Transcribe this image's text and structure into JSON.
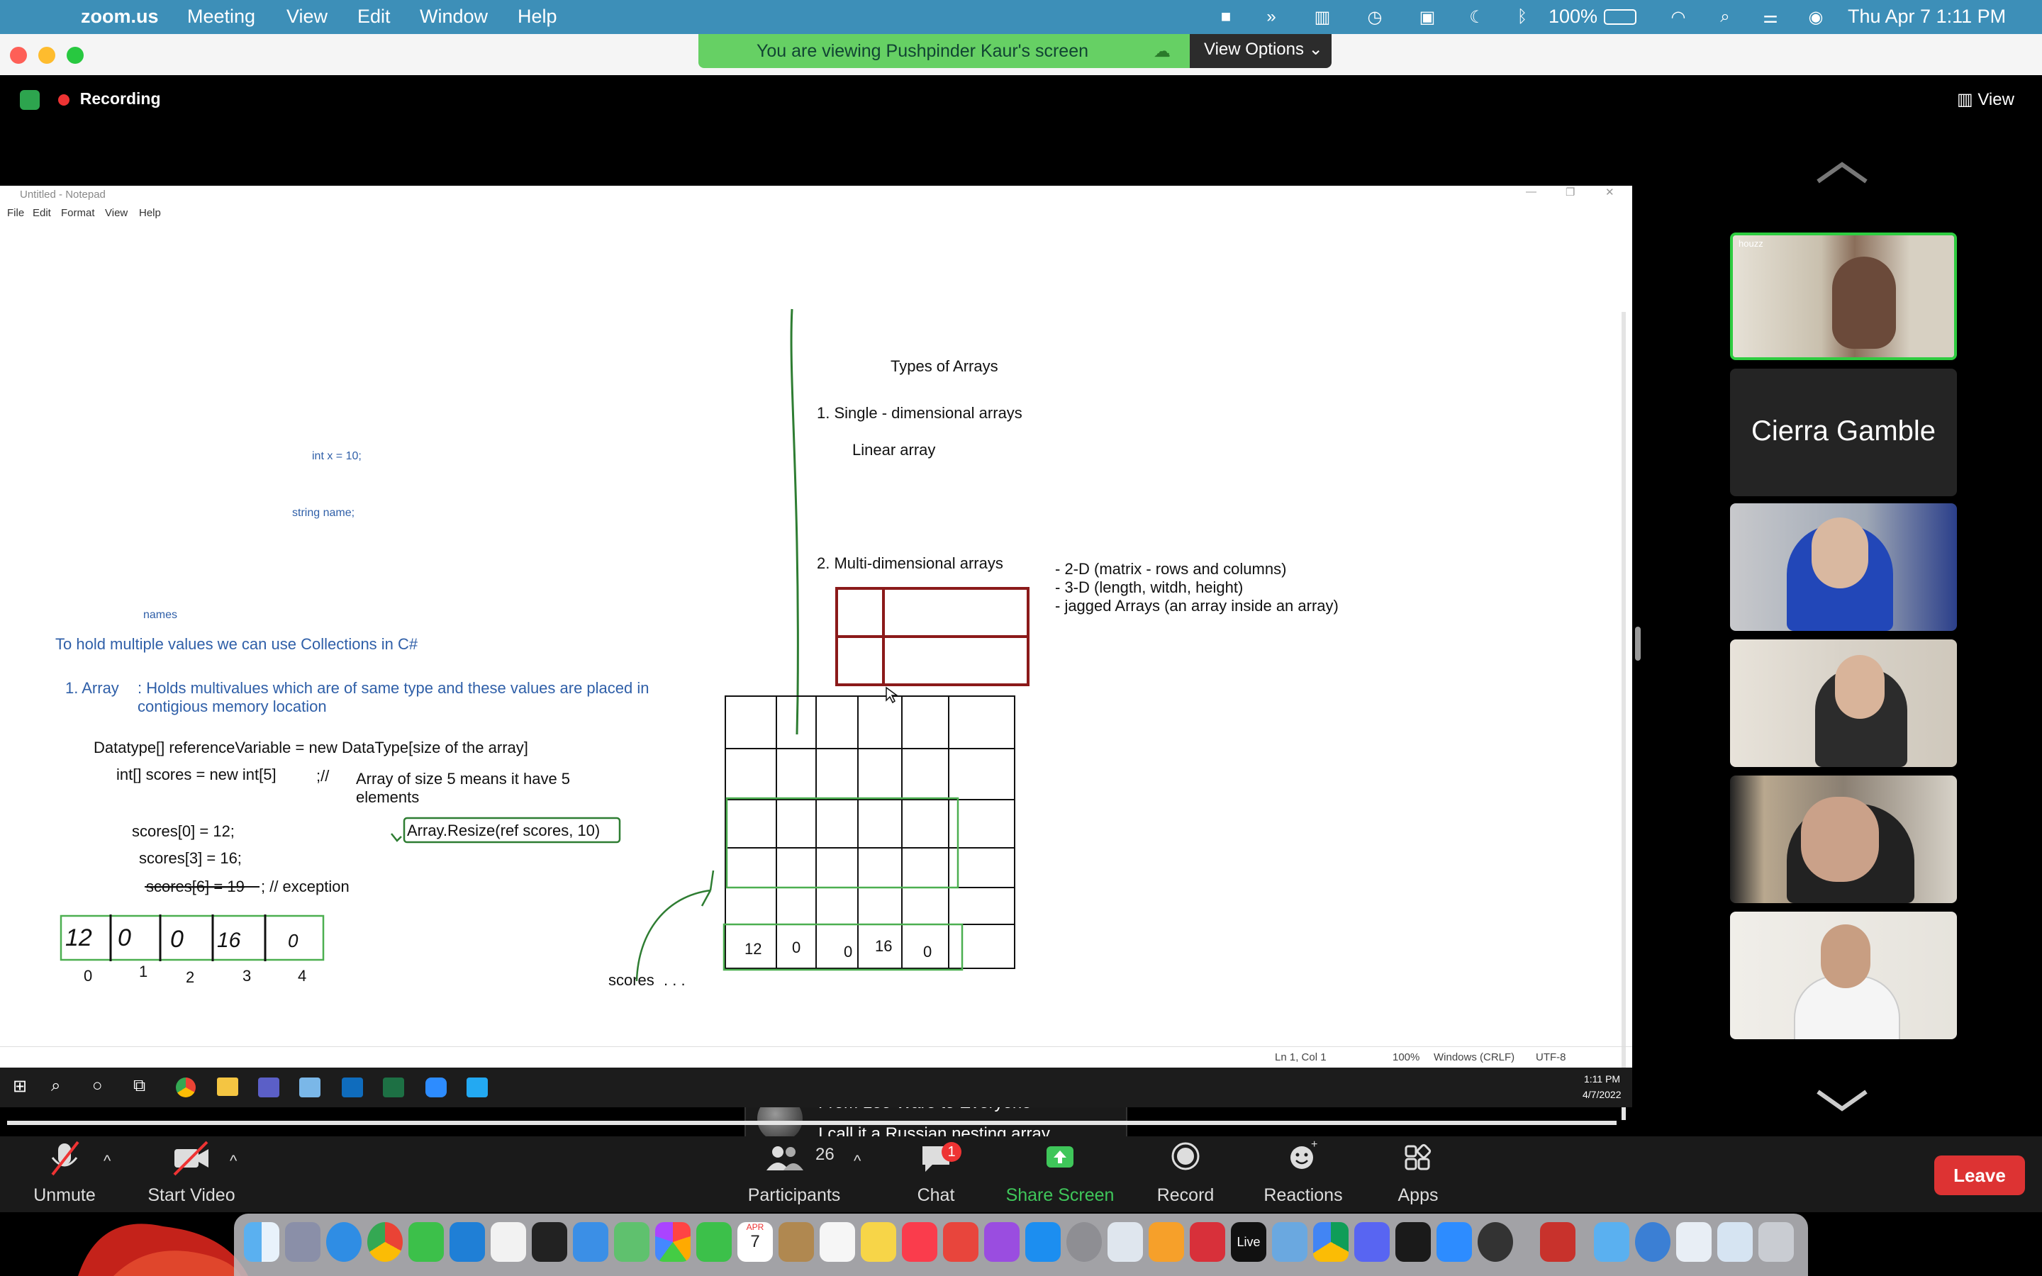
{
  "menubar": {
    "app_name": "zoom.us",
    "menus": [
      "Meeting",
      "View",
      "Edit",
      "Window",
      "Help"
    ],
    "battery": "100%",
    "clock": "Thu Apr 7  1:11 PM"
  },
  "banner": {
    "viewing_text": "You are viewing Pushpinder Kaur's screen",
    "view_options": "View Options"
  },
  "recording_label": "Recording",
  "view_button": "View",
  "notepad": {
    "title": "Untitled - Notepad",
    "menus": [
      "File",
      "Edit",
      "Format",
      "View",
      "Help"
    ],
    "status": {
      "position": "Ln 1, Col 1",
      "zoom": "100%",
      "line_endings": "Windows (CRLF)",
      "encoding": "UTF-8"
    },
    "taskbar_time": "1:11 PM",
    "taskbar_date": "4/7/2022"
  },
  "whiteboard": {
    "int_x": "int x = 10;",
    "string_name": "string name;",
    "names": "names",
    "collections": "To hold multiple values we can use Collections in C#",
    "array_num": "1. Array",
    "array_desc1": ": Holds multivalues which are of same type and these values are placed in",
    "array_desc2": "contigious memory location",
    "syntax": "Datatype[] referenceVariable = new DataType[size of the array]",
    "scores_decl": "int[] scores = new int[5]",
    "comment_marker": ";//",
    "comment1": "Array of size 5 means it have 5",
    "comment2": "elements",
    "resize": "Array.Resize(ref scores, 10)",
    "assign0": "scores[0] = 12;",
    "assign3": "scores[3] = 16;",
    "assign6_struck": "scores[6] = 19",
    "assign6_rest": "; // exception",
    "hand_values": [
      "12",
      "0",
      "0",
      "16",
      "0"
    ],
    "hand_indices": [
      "0",
      "1",
      "2",
      "3",
      "4"
    ],
    "scores_label": "scores",
    "grid_values": [
      "12",
      "0",
      "0",
      "16",
      "0"
    ],
    "types_title": "Types of Arrays",
    "single_dim": "1. Single - dimensional arrays",
    "linear": "Linear array",
    "multi_dim": "2. Multi-dimensional arrays",
    "multi_items": [
      "- 2-D (matrix - rows and columns)",
      "- 3-D (length, witdh, height)",
      "- jagged Arrays (an array inside an array)"
    ]
  },
  "gallery": {
    "active_name": "Cierra Gamble",
    "logo_text": "houzz"
  },
  "toast": {
    "from": "From Leo Ware to Everyone",
    "message": "I call it a Russian nesting array"
  },
  "toolbar": {
    "unmute": "Unmute",
    "start_video": "Start Video",
    "participants": "Participants",
    "participants_count": "26",
    "chat": "Chat",
    "chat_badge": "1",
    "share": "Share Screen",
    "record": "Record",
    "reactions": "Reactions",
    "apps": "Apps",
    "leave": "Leave"
  },
  "dock": {
    "live_label": "Live",
    "calendar_month": "APR",
    "calendar_day": "7"
  },
  "colors": {
    "menubar": "#3d8fb8",
    "banner_green": "#66d064",
    "share_green": "#3fc65a",
    "leave_red": "#dd3333",
    "ink_blue": "#2f5fa8",
    "marker_green": "#2e7d32",
    "marker_red": "#8b1a1a"
  }
}
